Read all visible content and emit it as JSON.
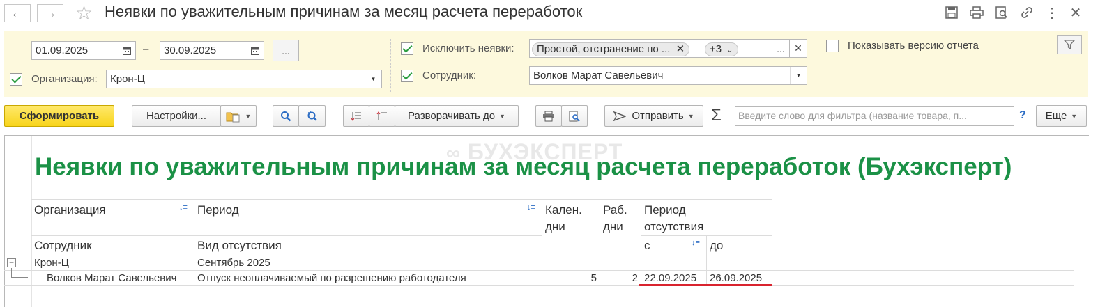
{
  "window": {
    "title": "Неявки по уважительным причинам за месяц расчета переработок"
  },
  "filters": {
    "date_from": "01.09.2025",
    "date_sep": "–",
    "date_to": "30.09.2025",
    "period_button": "...",
    "org_label": "Организация:",
    "org_value": "Крон-Ц",
    "exclude_label": "Исключить неявки:",
    "exclude_tag": "Простой, отстранение по ...",
    "exclude_more": "+3",
    "exclude_dots": "...",
    "employee_label": "Сотрудник:",
    "employee_value": "Волков Марат Савельевич",
    "show_version_label": "Показывать версию отчета"
  },
  "toolbar": {
    "generate": "Сформировать",
    "settings": "Настройки...",
    "expand": "Разворачивать до",
    "send": "Отправить",
    "sigma": "Σ",
    "search_placeholder": "Введите слово для фильтра (название товара, п...",
    "help": "?",
    "more": "Еще"
  },
  "report": {
    "watermark": "БУХЭКСПЕРТ",
    "title": "Неявки по уважительным причинам за месяц расчета переработок (Бухэксперт)",
    "headers": {
      "org": "Организация",
      "period": "Период",
      "cal_days_1": "Кален.",
      "cal_days_2": "дни",
      "work_days_1": "Раб.",
      "work_days_2": "дни",
      "absence_1": "Период",
      "absence_2": "отсутствия",
      "employee": "Сотрудник",
      "absence_type": "Вид отсутствия",
      "from": "с",
      "to": "до"
    },
    "group_row": {
      "org": "Крон-Ц",
      "period": "Сентябрь 2025"
    },
    "rows": [
      {
        "employee": "Волков Марат Савельевич",
        "type": "Отпуск неоплачиваемый по разрешению работодателя",
        "cal_days": "5",
        "work_days": "2",
        "from": "22.09.2025",
        "to": "26.09.2025"
      }
    ]
  },
  "colors": {
    "accent_green": "#1b9146",
    "underline_red": "#d9232e",
    "panel_bg": "#fdf9dd"
  }
}
